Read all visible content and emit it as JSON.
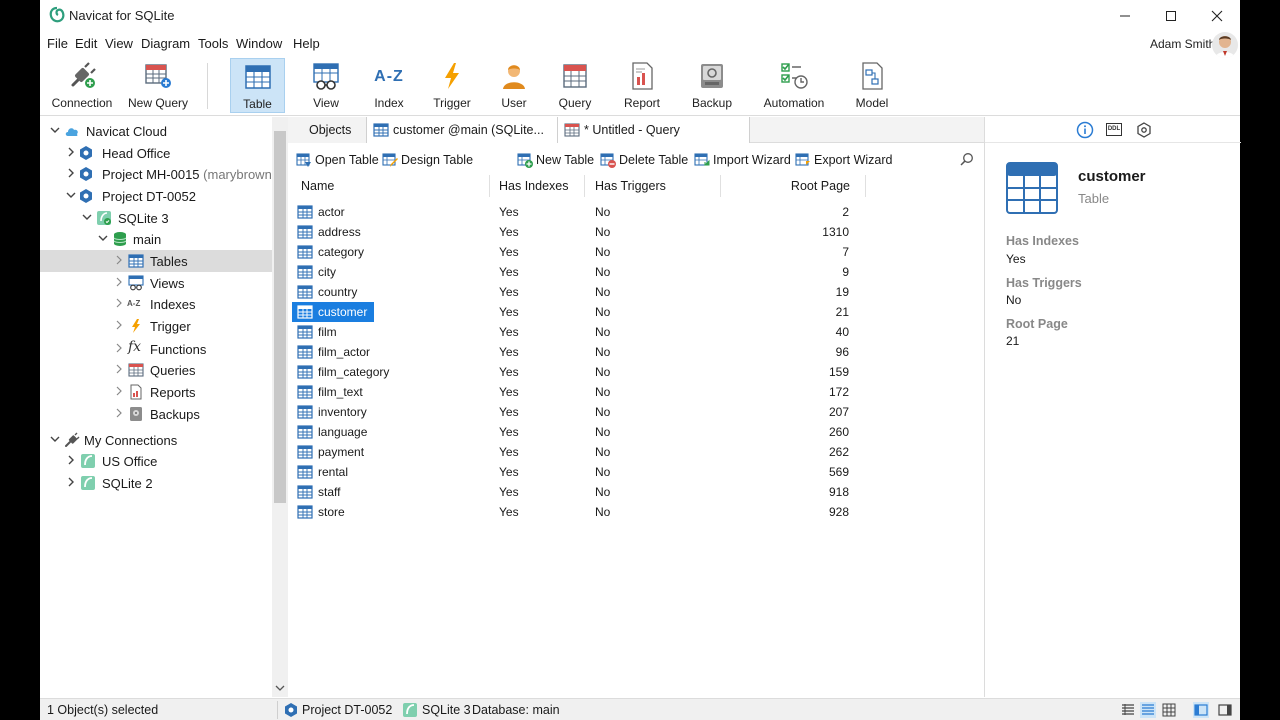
{
  "window": {
    "title": "Navicat for SQLite",
    "minimize_icon": "minimize-icon",
    "maximize_icon": "maximize-icon",
    "close_icon": "close-icon"
  },
  "menu": [
    "File",
    "Edit",
    "View",
    "Diagram",
    "Tools",
    "Window",
    "Help"
  ],
  "user": {
    "name": "Adam Smith"
  },
  "toolbar": {
    "connection": "Connection",
    "new_query": "New Query",
    "table": "Table",
    "view": "View",
    "index": "Index",
    "trigger": "Trigger",
    "user": "User",
    "query": "Query",
    "report": "Report",
    "backup": "Backup",
    "automation": "Automation",
    "model": "Model",
    "index_glyph": "A-Z",
    "active": "Table"
  },
  "nav": {
    "items": [
      {
        "label": "Navicat Cloud",
        "icon": "cloud-icon"
      },
      {
        "label": "Head Office",
        "icon": "project-icon"
      },
      {
        "label": "Project MH-0015",
        "sub": "(marybrown",
        "icon": "project-icon"
      },
      {
        "label": "Project DT-0052",
        "icon": "project-icon"
      },
      {
        "label": "SQLite 3",
        "icon": "sqlite-connection-icon"
      },
      {
        "label": "main",
        "icon": "database-icon"
      },
      {
        "label": "Tables",
        "icon": "table-icon"
      },
      {
        "label": "Views",
        "icon": "view-icon"
      },
      {
        "label": "Indexes",
        "icon": "index-icon"
      },
      {
        "label": "Trigger",
        "icon": "trigger-icon"
      },
      {
        "label": "Functions",
        "icon": "function-icon"
      },
      {
        "label": "Queries",
        "icon": "query-icon"
      },
      {
        "label": "Reports",
        "icon": "report-icon"
      },
      {
        "label": "Backups",
        "icon": "backup-icon"
      },
      {
        "label": "My Connections",
        "icon": "connections-icon"
      },
      {
        "label": "US Office",
        "icon": "sqlite-icon"
      },
      {
        "label": "SQLite 2",
        "icon": "sqlite-icon"
      }
    ],
    "selected": "Tables",
    "index_glyph": "A-Z",
    "function_glyph": "fx"
  },
  "tabs": {
    "objects": "Objects",
    "customer": "customer @main (SQLite...",
    "query": "* Untitled - Query"
  },
  "object_toolbar": {
    "open_table": "Open Table",
    "design_table": "Design Table",
    "new_table": "New Table",
    "delete_table": "Delete Table",
    "import_wizard": "Import Wizard",
    "export_wizard": "Export Wizard"
  },
  "table_list": {
    "columns": [
      "Name",
      "Has Indexes",
      "Has Triggers",
      "Root Page"
    ],
    "rows": [
      {
        "name": "actor",
        "has_indexes": "Yes",
        "has_triggers": "No",
        "root_page": "2"
      },
      {
        "name": "address",
        "has_indexes": "Yes",
        "has_triggers": "No",
        "root_page": "1310"
      },
      {
        "name": "category",
        "has_indexes": "Yes",
        "has_triggers": "No",
        "root_page": "7"
      },
      {
        "name": "city",
        "has_indexes": "Yes",
        "has_triggers": "No",
        "root_page": "9"
      },
      {
        "name": "country",
        "has_indexes": "Yes",
        "has_triggers": "No",
        "root_page": "19"
      },
      {
        "name": "customer",
        "has_indexes": "Yes",
        "has_triggers": "No",
        "root_page": "21"
      },
      {
        "name": "film",
        "has_indexes": "Yes",
        "has_triggers": "No",
        "root_page": "40"
      },
      {
        "name": "film_actor",
        "has_indexes": "Yes",
        "has_triggers": "No",
        "root_page": "96"
      },
      {
        "name": "film_category",
        "has_indexes": "Yes",
        "has_triggers": "No",
        "root_page": "159"
      },
      {
        "name": "film_text",
        "has_indexes": "Yes",
        "has_triggers": "No",
        "root_page": "172"
      },
      {
        "name": "inventory",
        "has_indexes": "Yes",
        "has_triggers": "No",
        "root_page": "207"
      },
      {
        "name": "language",
        "has_indexes": "Yes",
        "has_triggers": "No",
        "root_page": "260"
      },
      {
        "name": "payment",
        "has_indexes": "Yes",
        "has_triggers": "No",
        "root_page": "262"
      },
      {
        "name": "rental",
        "has_indexes": "Yes",
        "has_triggers": "No",
        "root_page": "569"
      },
      {
        "name": "staff",
        "has_indexes": "Yes",
        "has_triggers": "No",
        "root_page": "918"
      },
      {
        "name": "store",
        "has_indexes": "Yes",
        "has_triggers": "No",
        "root_page": "928"
      }
    ],
    "selected": "customer"
  },
  "info_panel": {
    "name": "customer",
    "type": "Table",
    "properties": [
      {
        "label": "Has Indexes",
        "value": "Yes"
      },
      {
        "label": "Has Triggers",
        "value": "No"
      },
      {
        "label": "Root Page",
        "value": "21"
      }
    ],
    "tab_icons": [
      "info-icon",
      "ddl-icon",
      "settings-icon"
    ],
    "ddl_glyph": "DDL"
  },
  "status_bar": {
    "selection": "1 Object(s) selected",
    "project": "Project DT-0052",
    "connection": "SQLite 3",
    "database": "Database: main"
  },
  "colors": {
    "accent": "#1a7ee0",
    "table_icon": "#2f6fb3",
    "selection_bg": "#cce4f7",
    "trigger": "#f5a000"
  }
}
